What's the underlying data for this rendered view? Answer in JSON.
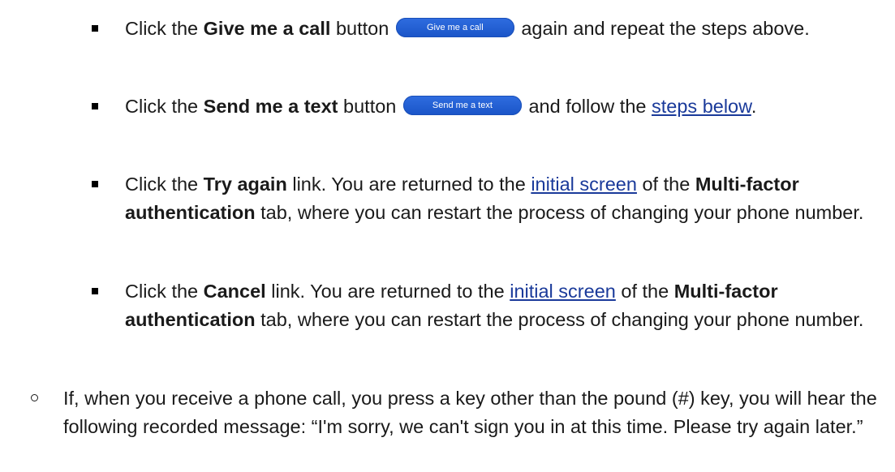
{
  "items": [
    {
      "type": "square",
      "pre": "Click the ",
      "strong": "Give me a call",
      "mid": " button ",
      "button_label": "Give me a call",
      "post": " again and repeat the steps above."
    },
    {
      "type": "square",
      "pre": "Click the ",
      "strong": "Send me a text",
      "mid": " button ",
      "button_label": "Send me a text",
      "post1": " and follow the ",
      "link": "steps below",
      "post2": "."
    },
    {
      "type": "square",
      "pre": "Click the ",
      "strong": "Try again",
      "mid": " link. You are returned to the ",
      "link": "initial screen",
      "mid2": " of the ",
      "strong2": "Multi-factor authentication",
      "post": " tab, where you can restart the process of changing your phone number."
    },
    {
      "type": "square",
      "pre": "Click the ",
      "strong": "Cancel",
      "mid": " link. You are returned to the ",
      "link": "initial screen",
      "mid2": " of the ",
      "strong2": "Multi-factor authentication",
      "post": " tab, where you can restart the process of changing your phone number."
    },
    {
      "type": "circle",
      "text": "If, when you receive a phone call, you press a key other than the pound (#) key, you will hear the following recorded message: “I'm sorry, we can't sign you in at this time. Please try again later.”"
    }
  ]
}
